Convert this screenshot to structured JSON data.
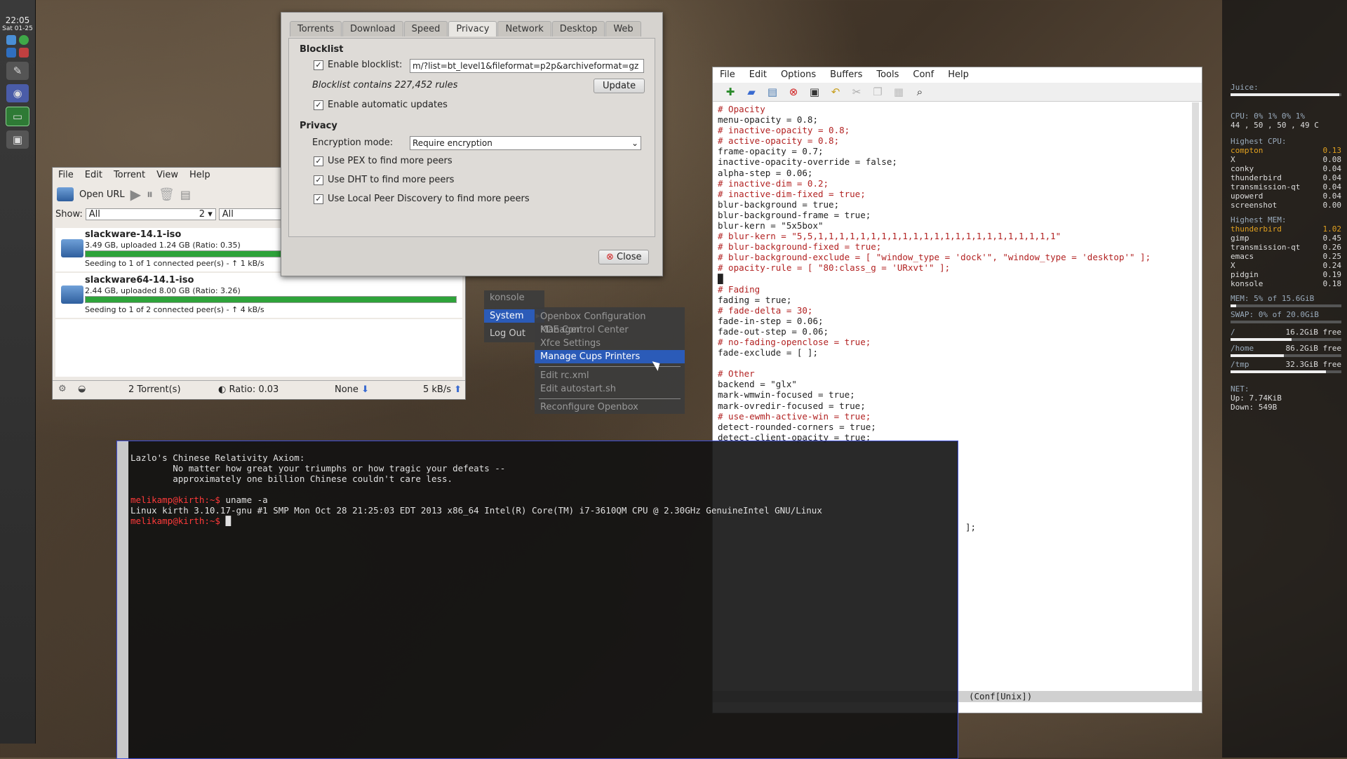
{
  "dock": {
    "time": "22:05",
    "date": "Sat 01-25",
    "icons": [
      "signal-icon",
      "browser-icon",
      "mail-icon",
      "settings-icon",
      "konsole-icon",
      "screenshot-icon"
    ]
  },
  "prefs": {
    "tabs": [
      "Torrents",
      "Download",
      "Speed",
      "Privacy",
      "Network",
      "Desktop",
      "Web"
    ],
    "active_tab": "Privacy",
    "blocklist_section": "Blocklist",
    "enable_blocklist_label": "Enable blocklist:",
    "blocklist_url": "m/?list=bt_level1&fileformat=p2p&archiveformat=gz",
    "blocklist_rules": "Blocklist contains 227,452 rules",
    "update_button": "Update",
    "auto_updates_label": "Enable automatic updates",
    "privacy_section": "Privacy",
    "encryption_label": "Encryption mode:",
    "encryption_value": "Require encryption",
    "pex_label": "Use PEX to find more peers",
    "dht_label": "Use DHT to find more peers",
    "lpd_label": "Use Local Peer Discovery to find more peers",
    "close_button": "Close"
  },
  "transmission": {
    "menu": [
      "File",
      "Edit",
      "Torrent",
      "View",
      "Help"
    ],
    "open_url": "Open URL",
    "show_label": "Show:",
    "filter1": "All",
    "filter1_count": "2",
    "filter2": "All",
    "torrents": [
      {
        "name": "slackware-14.1-iso",
        "info": "3.49 GB, uploaded 1.24 GB (Ratio: 0.35)",
        "status": "Seeding to 1 of 1 connected peer(s) - ↑ 1 kB/s",
        "progress": 1.0
      },
      {
        "name": "slackware64-14.1-iso",
        "info": "2.44 GB, uploaded 8.00 GB (Ratio: 3.26)",
        "status": "Seeding to 1 of 2 connected peer(s) - ↑ 4 kB/s",
        "progress": 1.0
      }
    ],
    "status_count": "2 Torrent(s)",
    "status_ratio": "Ratio: 0.03",
    "status_down": "None",
    "status_up": "5 kB/s"
  },
  "obmenu": {
    "title": "konsole",
    "items": [
      "System",
      "Log Out"
    ],
    "submenu": [
      "Openbox Configuration Manager",
      "KDE Control Center",
      "Xfce Settings",
      "Manage Cups Printers",
      "Edit rc.xml",
      "Edit autostart.sh",
      "Reconfigure Openbox"
    ],
    "selected": "Manage Cups Printers"
  },
  "emacs": {
    "menu": [
      "File",
      "Edit",
      "Options",
      "Buffers",
      "Tools",
      "Conf",
      "Help"
    ],
    "lines": [
      {
        "t": "# Opacity",
        "c": "r"
      },
      {
        "t": "menu-opacity = 0.8;",
        "c": ""
      },
      {
        "t": "# inactive-opacity = 0.8;",
        "c": "r"
      },
      {
        "t": "# active-opacity = 0.8;",
        "c": "r"
      },
      {
        "t": "frame-opacity = 0.7;",
        "c": ""
      },
      {
        "t": "inactive-opacity-override = false;",
        "c": ""
      },
      {
        "t": "alpha-step = 0.06;",
        "c": ""
      },
      {
        "t": "# inactive-dim = 0.2;",
        "c": "r"
      },
      {
        "t": "# inactive-dim-fixed = true;",
        "c": "r"
      },
      {
        "t": "blur-background = true;",
        "c": ""
      },
      {
        "t": "blur-background-frame = true;",
        "c": ""
      },
      {
        "t": "blur-kern = \"5x5box\"",
        "c": ""
      },
      {
        "t": "# blur-kern = \"5,5,1,1,1,1,1,1,1,1,1,1,1,1,1,1,1,1,1,1,1,1,1,1,1\"",
        "c": "r"
      },
      {
        "t": "# blur-background-fixed = true;",
        "c": "r"
      },
      {
        "t": "# blur-background-exclude = [ \"window_type = 'dock'\", \"window_type = 'desktop'\" ];",
        "c": "r"
      },
      {
        "t": "# opacity-rule = [ \"80:class_g = 'URxvt'\" ];",
        "c": "r"
      },
      {
        "t": "█",
        "c": ""
      },
      {
        "t": "# Fading",
        "c": "r"
      },
      {
        "t": "fading = true;",
        "c": ""
      },
      {
        "t": "# fade-delta = 30;",
        "c": "r"
      },
      {
        "t": "fade-in-step = 0.06;",
        "c": ""
      },
      {
        "t": "fade-out-step = 0.06;",
        "c": ""
      },
      {
        "t": "# no-fading-openclose = true;",
        "c": "r"
      },
      {
        "t": "fade-exclude = [ ];",
        "c": ""
      },
      {
        "t": "",
        "c": ""
      },
      {
        "t": "# Other",
        "c": "r"
      },
      {
        "t": "backend = \"glx\"",
        "c": ""
      },
      {
        "t": "mark-wmwin-focused = true;",
        "c": ""
      },
      {
        "t": "mark-ovredir-focused = true;",
        "c": ""
      },
      {
        "t": "# use-ewmh-active-win = true;",
        "c": "r"
      },
      {
        "t": "detect-rounded-corners = true;",
        "c": ""
      },
      {
        "t": "detect-client-opacity = true;",
        "c": ""
      }
    ],
    "mode_line": "(Conf[Unix])",
    "overflow_text": "];"
  },
  "konsole": {
    "lines": [
      {
        "t": "Lazlo's Chinese Relativity Axiom:",
        "c": ""
      },
      {
        "t": "        No matter how great your triumphs or how tragic your defeats --",
        "c": ""
      },
      {
        "t": "        approximately one billion Chinese couldn't care less.",
        "c": ""
      },
      {
        "t": "",
        "c": ""
      },
      {
        "p": "melikamp@kirth:~$",
        "t": " uname -a"
      },
      {
        "t": "Linux kirth 3.10.17-gnu #1 SMP Mon Oct 28 21:25:03 EDT 2013 x86_64 Intel(R) Core(TM) i7-3610QM CPU @ 2.30GHz GenuineIntel GNU/Linux",
        "c": ""
      },
      {
        "p": "melikamp@kirth:~$",
        "t": " █"
      }
    ]
  },
  "conky": {
    "juice_label": "Juice:",
    "juice": 0.98,
    "cpu_line": "CPU: 0% 1% 0% 1%",
    "temp_line": "44 , 50 , 50 , 49  C",
    "highest_cpu_label": "Highest CPU:",
    "highest_cpu": [
      [
        "compton",
        "0.13"
      ],
      [
        "X",
        "0.08"
      ],
      [
        "conky",
        "0.04"
      ],
      [
        "thunderbird",
        "0.04"
      ],
      [
        "transmission-qt",
        "0.04"
      ],
      [
        "upowerd",
        "0.04"
      ],
      [
        "screenshot",
        "0.00"
      ]
    ],
    "highest_mem_label": "Highest MEM:",
    "highest_mem": [
      [
        "thunderbird",
        "1.02"
      ],
      [
        "gimp",
        "0.45"
      ],
      [
        "transmission-qt",
        "0.26"
      ],
      [
        "emacs",
        "0.25"
      ],
      [
        "X",
        "0.24"
      ],
      [
        "pidgin",
        "0.19"
      ],
      [
        "konsole",
        "0.18"
      ]
    ],
    "mem_line": "MEM:   5% of 15.6GiB",
    "mem": 0.05,
    "swap_line": "SWAP:  0% of 20.0GiB",
    "swap": 0.0,
    "root_label": "/",
    "root_free": "16.2GiB free",
    "root_use": 0.55,
    "home_label": "/home",
    "home_free": "86.2GiB free",
    "home_use": 0.48,
    "tmp_label": "/tmp",
    "tmp_free": "32.3GiB free",
    "tmp_use": 0.86,
    "net_label": "NET:",
    "up": "Up: 7.74KiB",
    "down": "Down: 549B"
  }
}
